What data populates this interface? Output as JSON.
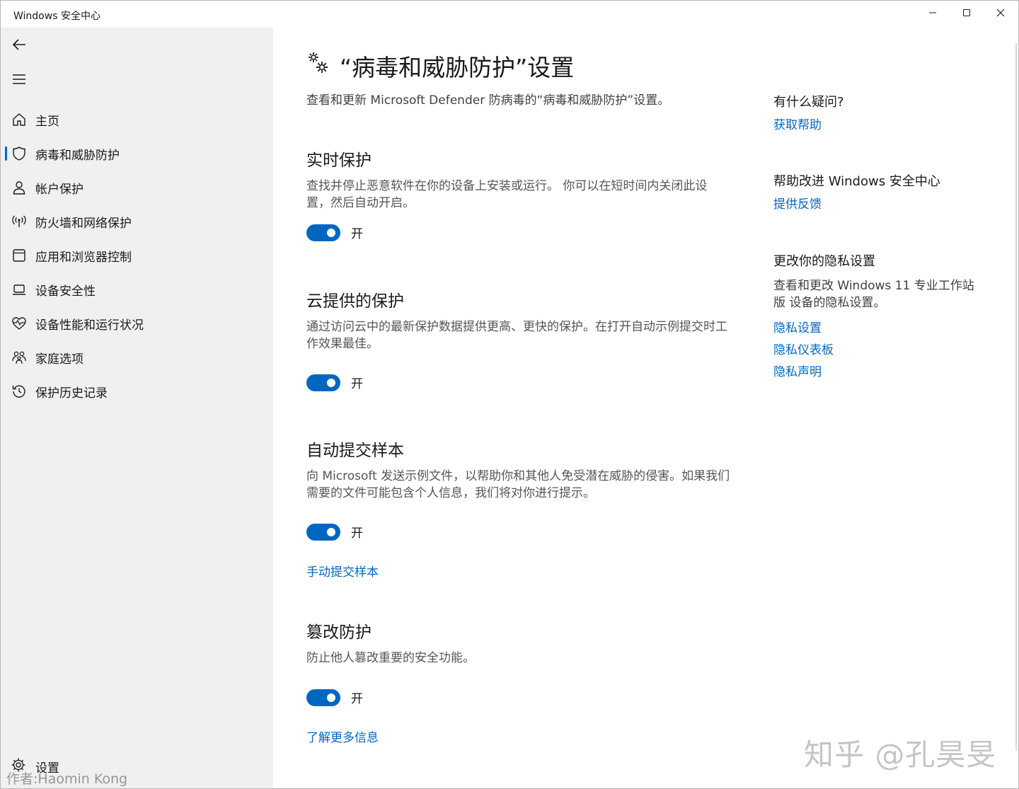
{
  "window": {
    "title": "Windows 安全中心"
  },
  "sidebar": {
    "items": [
      {
        "label": "主页",
        "icon": "home-icon"
      },
      {
        "label": "病毒和威胁防护",
        "icon": "shield-icon",
        "active": true
      },
      {
        "label": "帐户保护",
        "icon": "person-icon"
      },
      {
        "label": "防火墙和网络保护",
        "icon": "antenna-icon"
      },
      {
        "label": "应用和浏览器控制",
        "icon": "app-window-icon"
      },
      {
        "label": "设备安全性",
        "icon": "laptop-icon"
      },
      {
        "label": "设备性能和运行状况",
        "icon": "heart-pulse-icon"
      },
      {
        "label": "家庭选项",
        "icon": "family-icon"
      },
      {
        "label": "保护历史记录",
        "icon": "history-icon"
      }
    ],
    "settings_label": "设置"
  },
  "main": {
    "title": "“病毒和威胁防护”设置",
    "subtitle": "查看和更新 Microsoft Defender 防病毒的“病毒和威胁防护”设置。",
    "sections": [
      {
        "heading": "实时保护",
        "description": "查找并停止恶意软件在你的设备上安装或运行。 你可以在短时间内关闭此设置，然后自动开启。",
        "toggle_label": "开"
      },
      {
        "heading": "云提供的保护",
        "description": "通过访问云中的最新保护数据提供更高、更快的保护。在打开自动示例提交时工作效果最佳。",
        "toggle_label": "开"
      },
      {
        "heading": "自动提交样本",
        "description": "向 Microsoft 发送示例文件，以帮助你和其他人免受潜在威胁的侵害。如果我们需要的文件可能包含个人信息，我们将对你进行提示。",
        "toggle_label": "开",
        "link": "手动提交样本"
      },
      {
        "heading": "篡改防护",
        "description": "防止他人篡改重要的安全功能。",
        "toggle_label": "开",
        "link": "了解更多信息"
      }
    ]
  },
  "aside": {
    "question_heading": "有什么疑问?",
    "get_help": "获取帮助",
    "improve_heading": "帮助改进 Windows 安全中心",
    "feedback": "提供反馈",
    "privacy_heading": "更改你的隐私设置",
    "privacy_text": "查看和更改 Windows 11 专业工作站版 设备的隐私设置。",
    "privacy_links": [
      "隐私设置",
      "隐私仪表板",
      "隐私声明"
    ]
  },
  "watermarks": {
    "author": "作者:Haomin Kong",
    "zhihu": "知乎 @孔昊旻"
  },
  "colors": {
    "accent": "#0067c0",
    "sidebar_bg": "#f0f0f0"
  }
}
